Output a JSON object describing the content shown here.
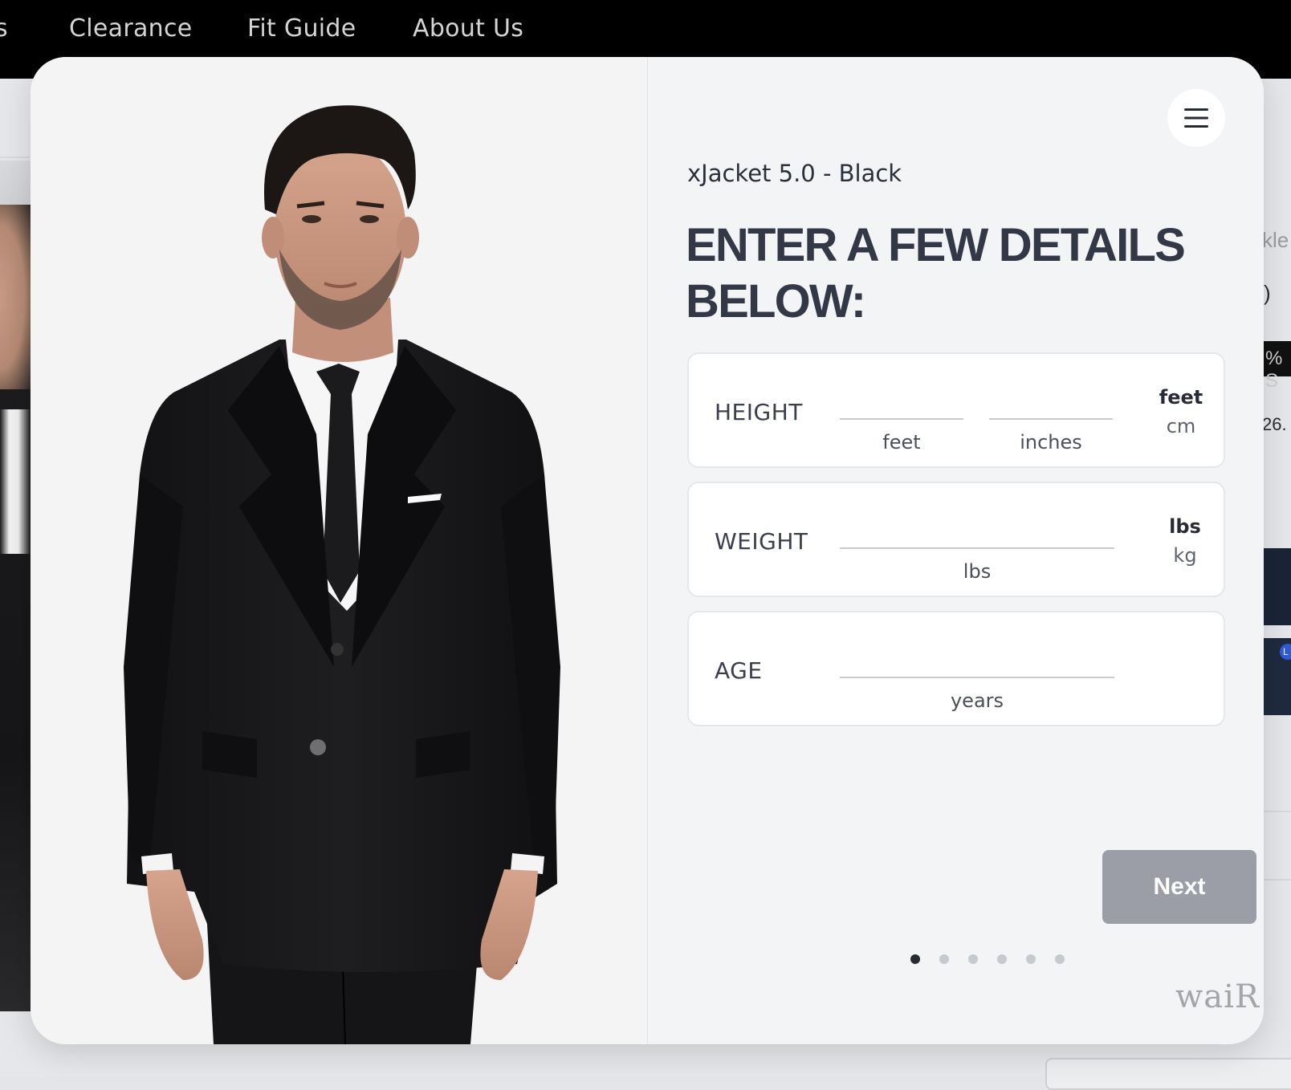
{
  "topnav": {
    "items": [
      {
        "label": "s"
      },
      {
        "label": "Clearance"
      },
      {
        "label": "Fit Guide"
      },
      {
        "label": "About Us"
      }
    ]
  },
  "background": {
    "right_texts": [
      "kle",
      ")",
      "26."
    ],
    "badge_text": "% S",
    "dot_text": "L"
  },
  "modal": {
    "product_name": "xJacket 5.0 - Black",
    "heading_line1": "ENTER A FEW DETAILS",
    "heading_line2": "BELOW:",
    "menu_icon": "hamburger-menu-icon",
    "fields": {
      "height": {
        "label": "HEIGHT",
        "feet_value": "",
        "feet_caption": "feet",
        "inches_value": "",
        "inches_caption": "inches",
        "units": [
          "feet",
          "cm"
        ],
        "selected_unit": "feet"
      },
      "weight": {
        "label": "WEIGHT",
        "value": "",
        "caption": "lbs",
        "units": [
          "lbs",
          "kg"
        ],
        "selected_unit": "lbs"
      },
      "age": {
        "label": "AGE",
        "value": "",
        "caption": "years"
      }
    },
    "next_label": "Next",
    "progress": {
      "total_steps": 6,
      "current_step": 1
    },
    "brand": "waiR",
    "colors": {
      "heading": "#323846",
      "next_button": "#9b9ea6",
      "active_dot": "#252a35"
    }
  }
}
